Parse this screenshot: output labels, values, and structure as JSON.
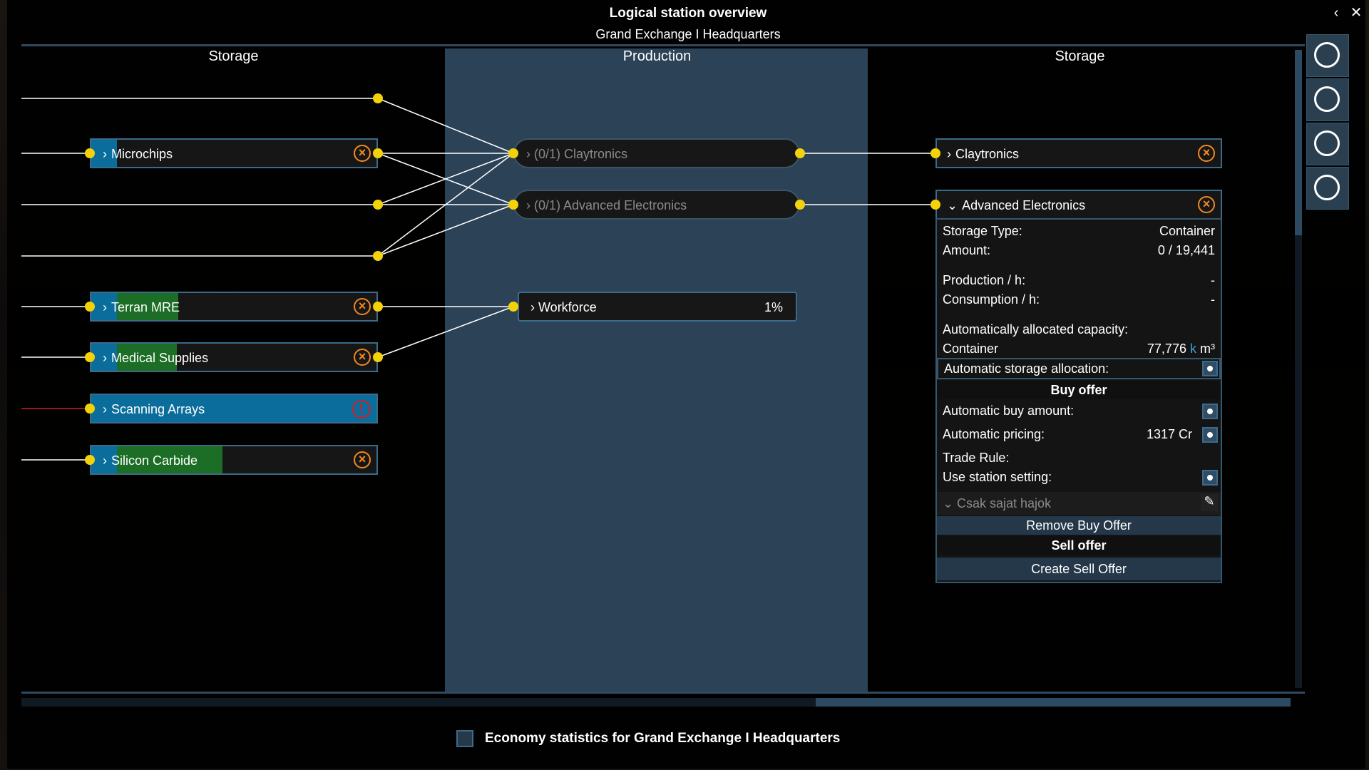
{
  "window": {
    "title": "Logical station overview",
    "subtitle": "Grand Exchange I Headquarters",
    "back_icon": "chevron-left-icon",
    "close_icon": "close-icon"
  },
  "columns": {
    "left": "Storage",
    "middle": "Production",
    "right": "Storage"
  },
  "left_storage": [
    {
      "label": "Microchips",
      "status_icon": "cancel-icon",
      "fill_pct": 0
    },
    {
      "label": "Terran MRE",
      "status_icon": "cancel-icon",
      "fill_pct": 30
    },
    {
      "label": "Medical Supplies",
      "status_icon": "cancel-icon",
      "fill_pct": 25
    },
    {
      "label": "Scanning Arrays",
      "status_icon": "warning-icon",
      "fill_pct": 100,
      "warning": true
    },
    {
      "label": "Silicon Carbide",
      "status_icon": "cancel-icon",
      "fill_pct": 48
    }
  ],
  "production": [
    {
      "label": "(0/1) Claytronics"
    },
    {
      "label": "(0/1) Advanced Electronics"
    },
    {
      "label": "Workforce",
      "value": "1%"
    }
  ],
  "right_storage": [
    {
      "label": "Claytronics",
      "expanded": false
    },
    {
      "label": "Advanced Electronics",
      "expanded": true
    }
  ],
  "details": {
    "storage_type_label": "Storage Type:",
    "storage_type_value": "Container",
    "amount_label": "Amount:",
    "amount_value": "0 / 19,441",
    "production_label": "Production / h:",
    "production_value": "-",
    "consumption_label": "Consumption / h:",
    "consumption_value": "-",
    "auto_capacity_label": "Automatically allocated capacity:",
    "container_label": "Container",
    "container_value": "77,776",
    "container_k": "k",
    "container_unit": "m³",
    "auto_storage_label": "Automatic storage allocation:",
    "buy_offer_header": "Buy offer",
    "auto_buy_label": "Automatic buy amount:",
    "auto_pricing_label": "Automatic pricing:",
    "auto_pricing_value": "1317 Cr",
    "trade_rule_label": "Trade Rule:",
    "use_station_label": "Use station setting:",
    "trade_rule_value": "Csak sajat hajok",
    "remove_buy_label": "Remove Buy Offer",
    "sell_offer_header": "Sell offer",
    "create_sell_label": "Create Sell Offer"
  },
  "sidebar_icons": [
    "compass-icon",
    "share-icon",
    "credits-icon",
    "flask-icon"
  ],
  "footer": {
    "label": "Economy statistics for Grand Exchange I Headquarters"
  },
  "colors": {
    "accent": "#0a6d9c",
    "node": "#f4d20a",
    "cancel": "#f08a20",
    "warning": "#d0202a",
    "fill": "#1c6d25",
    "panel": "#2c4257"
  }
}
